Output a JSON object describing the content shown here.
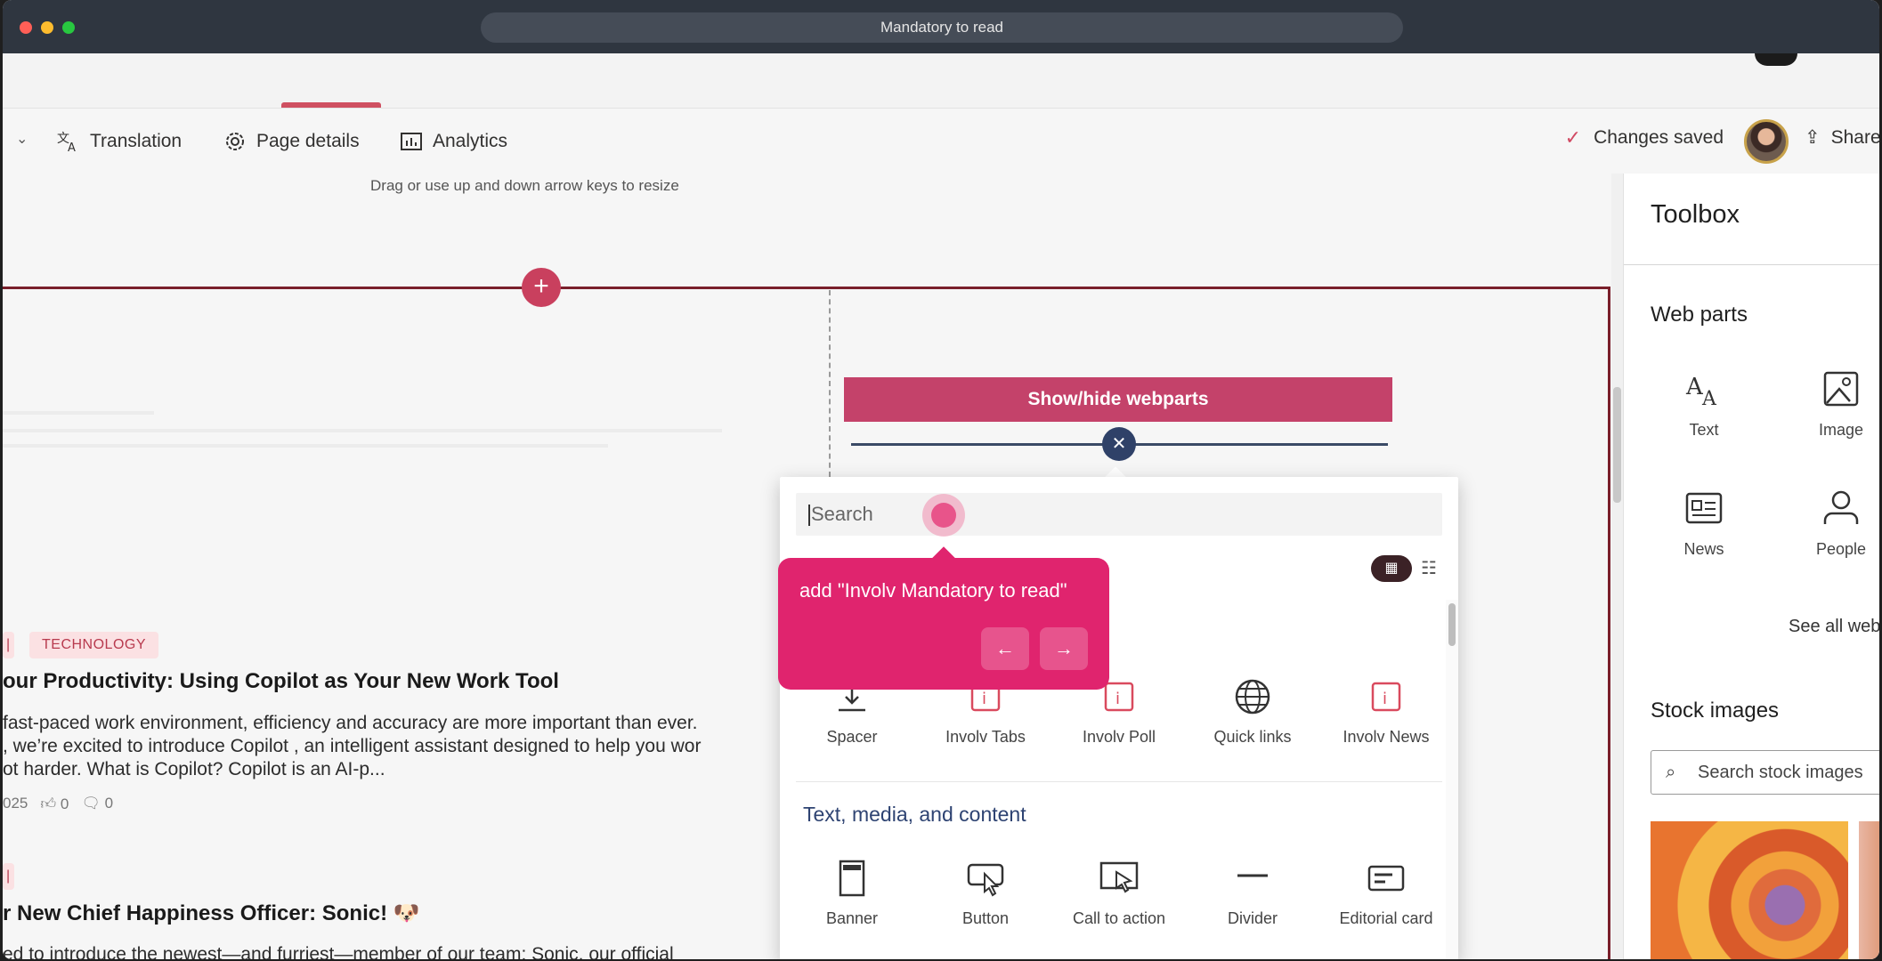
{
  "window": {
    "title": "Mandatory to read"
  },
  "commandbar": {
    "translation": "Translation",
    "page_details": "Page details",
    "analytics": "Analytics",
    "changes_saved": "Changes saved",
    "share": "Share"
  },
  "resize_hint": "Drag or use up and down arrow keys to resize",
  "news": {
    "item1": {
      "tag": "TECHNOLOGY",
      "title": "our Productivity: Using Copilot as Your New Work Tool",
      "body": [
        "fast-paced work environment, efficiency and accuracy are more important than ever.",
        ", we’re excited to introduce Copilot , an intelligent assistant designed to help you wor",
        "ot harder. What is Copilot? Copilot is an AI-p..."
      ],
      "date": "025",
      "likes": "0",
      "comments": "0"
    },
    "item2": {
      "title": "r New Chief Happiness Officer: Sonic! 🐶",
      "body": "ed to introduce the newest—and furriest—member of our team: Sonic, our official"
    }
  },
  "webpart_picker": {
    "show_hide": "Show/hide webparts",
    "search_placeholder": "Search",
    "row1": [
      "Spacer",
      "Involv Tabs",
      "Involv Poll",
      "Quick links",
      "Involv News"
    ],
    "section_title": "Text, media, and content",
    "row2": [
      "Banner",
      "Button",
      "Call to action",
      "Divider",
      "Editorial card"
    ]
  },
  "tour": {
    "message": "add \"Involv Mandatory to read\"",
    "prev": "←",
    "next": "→"
  },
  "toolbox": {
    "title": "Toolbox",
    "web_parts_heading": "Web parts",
    "tiles": [
      "Text",
      "Image",
      "News",
      "People"
    ],
    "see_all": "See all web parts",
    "stock_heading": "Stock images",
    "stock_search_placeholder": "Search stock images"
  }
}
